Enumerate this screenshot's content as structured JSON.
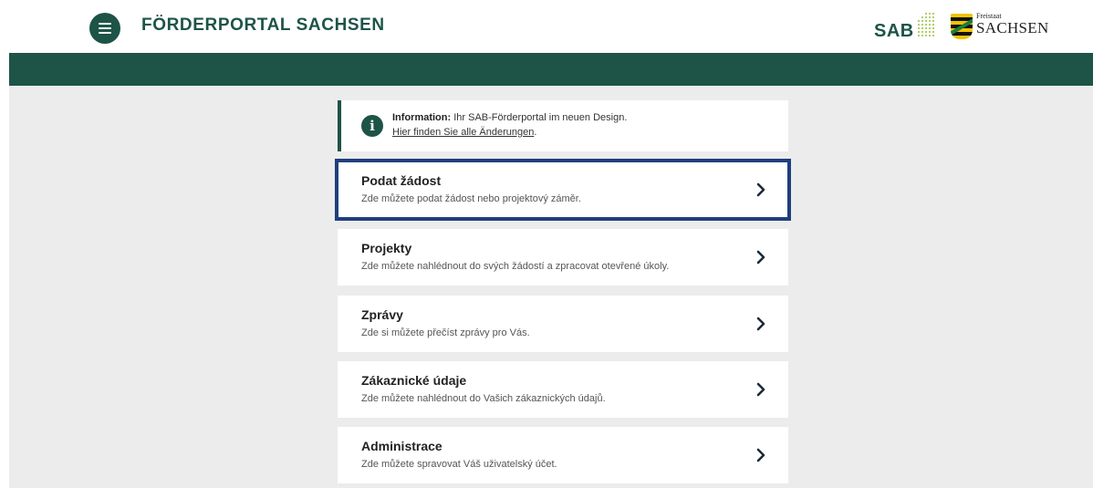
{
  "header": {
    "brand": "FÖRDERPORTAL SACHSEN",
    "sab_logo_text": "SAB",
    "sachsen_logo": {
      "small": "Freistaat",
      "big": "SACHSEN"
    }
  },
  "info": {
    "label": "Information:",
    "text": " Ihr SAB-Förderportal im neuen Design.",
    "link": "Hier finden Sie alle Änderungen",
    "link_suffix": "."
  },
  "cards": [
    {
      "title": "Podat žádost",
      "desc": "Zde můžete podat žádost nebo projektový záměr.",
      "selected": true
    },
    {
      "title": "Projekty",
      "desc": "Zde můžete nahlédnout do svých žádostí a zpracovat otevřené úkoly.",
      "selected": false
    },
    {
      "title": "Zprávy",
      "desc": "Zde si můžete přečíst zprávy pro Vás.",
      "selected": false
    },
    {
      "title": "Zákaznické údaje",
      "desc": "Zde můžete nahlédnout do Vašich zákaznických údajů.",
      "selected": false
    },
    {
      "title": "Administrace",
      "desc": "Zde můžete spravovat Váš uživatelský účet.",
      "selected": false
    }
  ],
  "icons": {
    "menu": "hamburger-menu-icon",
    "info": "info-icon",
    "chevron": "chevron-right-icon"
  },
  "colors": {
    "primary": "#1d5447",
    "selection_outline": "#1f3f7d",
    "background": "#ececec",
    "sab_dots": "#9bc23c"
  }
}
